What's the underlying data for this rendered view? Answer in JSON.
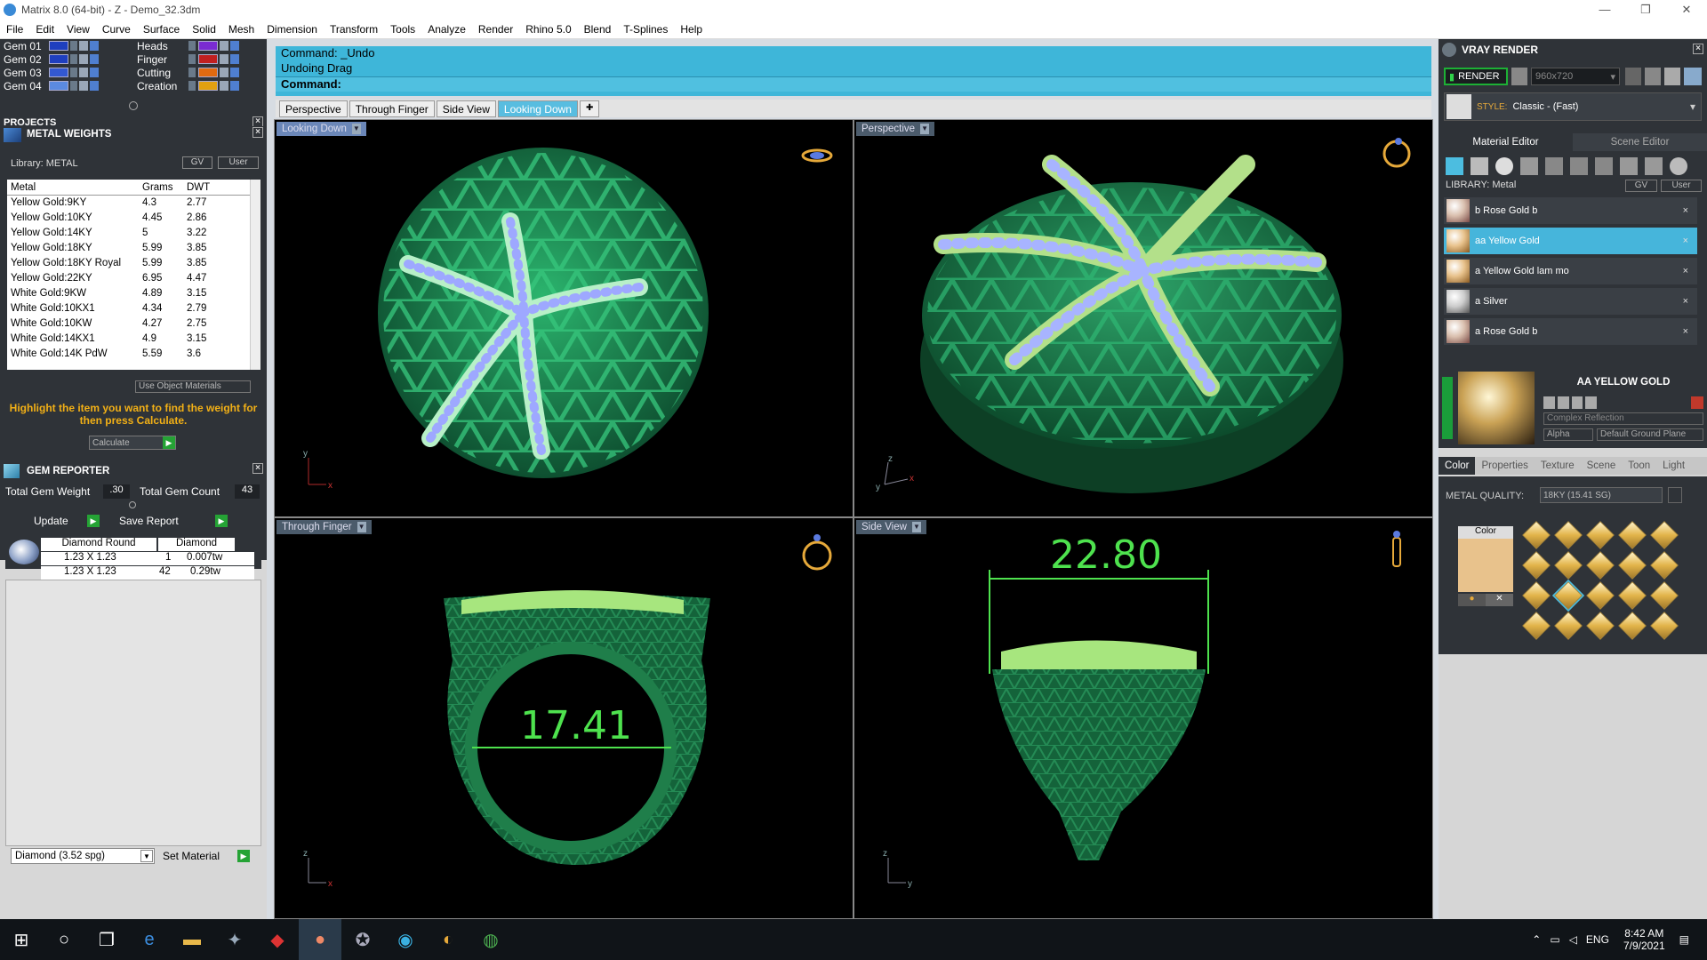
{
  "window": {
    "title": "Matrix 8.0 (64-bit) - Z - Demo_32.3dm",
    "controls": [
      "—",
      "❐",
      "✕"
    ]
  },
  "menu": [
    "File",
    "Edit",
    "View",
    "Curve",
    "Surface",
    "Solid",
    "Mesh",
    "Dimension",
    "Transform",
    "Tools",
    "Analyze",
    "Render",
    "Rhino 5.0",
    "Blend",
    "T-Splines",
    "Help"
  ],
  "layers": {
    "left": [
      "Gem 01",
      "Gem 02",
      "Gem 03",
      "Gem 04"
    ],
    "right": [
      "Heads",
      "Finger",
      "Cutting",
      "Creation"
    ],
    "left_colors": [
      "#1f3fbf",
      "#1f3fbf",
      "#3358d0",
      "#5b8ae0"
    ],
    "right_colors": [
      "#7a2bd1",
      "#c02020",
      "#e06a10",
      "#e2a010"
    ]
  },
  "projects": {
    "title": "PROJECTS"
  },
  "metal_weights": {
    "title": "METAL WEIGHTS",
    "library_label": "Library: METAL",
    "gv_label": "GV",
    "user_label": "User",
    "columns": [
      "Metal",
      "Grams",
      "DWT"
    ],
    "rows": [
      [
        "Yellow Gold:9KY",
        "4.3",
        "2.77"
      ],
      [
        "Yellow Gold:10KY",
        "4.45",
        "2.86"
      ],
      [
        "Yellow Gold:14KY",
        "5",
        "3.22"
      ],
      [
        "Yellow Gold:18KY",
        "5.99",
        "3.85"
      ],
      [
        "Yellow Gold:18KY Royal",
        "5.99",
        "3.85"
      ],
      [
        "Yellow Gold:22KY",
        "6.95",
        "4.47"
      ],
      [
        "White Gold:9KW",
        "4.89",
        "3.15"
      ],
      [
        "White Gold:10KX1",
        "4.34",
        "2.79"
      ],
      [
        "White Gold:10KW",
        "4.27",
        "2.75"
      ],
      [
        "White Gold:14KX1",
        "4.9",
        "3.15"
      ],
      [
        "White Gold:14K PdW",
        "5.59",
        "3.6"
      ]
    ],
    "use_object_materials": "Use Object Materials",
    "hint": "Highlight the item you want to find the weight for then press Calculate.",
    "calculate": "Calculate"
  },
  "gem_reporter": {
    "title": "GEM REPORTER",
    "total_weight_label": "Total Gem Weight",
    "total_weight": ".30",
    "total_count_label": "Total Gem Count",
    "total_count": "43",
    "update": "Update",
    "save_report": "Save Report",
    "columns": [
      "Diamond Round",
      "Diamond"
    ],
    "rows": [
      [
        "1.23 X 1.23",
        "1",
        "0.007tw"
      ],
      [
        "1.23 X 1.23",
        "42",
        "0.29tw"
      ]
    ],
    "material_select": "Diamond     (3.52 spg)",
    "set_material": "Set Material"
  },
  "command": {
    "line1": "Command: _Undo",
    "line2": "Undoing Drag",
    "prompt": "Command:"
  },
  "viewport_tabs": [
    "Perspective",
    "Through Finger",
    "Side View",
    "Looking Down"
  ],
  "active_tab": "Looking Down",
  "add_tab_symbol": "✚",
  "viewports": {
    "top_left": "Looking Down",
    "top_right": "Perspective",
    "bottom_left": "Through Finger",
    "bottom_right": "Side View"
  },
  "axis_labels": {
    "tl": [
      "y",
      "x"
    ],
    "tr": [
      "z",
      "y",
      "x"
    ],
    "bl": [
      "z",
      "x"
    ],
    "br": [
      "z",
      "y"
    ]
  },
  "dimensions": {
    "width": "22.80",
    "finger": "17.41"
  },
  "vray": {
    "title": "VRAY RENDER",
    "render_btn": "RENDER",
    "resolution": "960x720",
    "style_label": "STYLE:",
    "style_value": "Classic - (Fast)",
    "tabs": [
      "Material Editor",
      "Scene Editor"
    ],
    "library_label": "LIBRARY: Metal",
    "gv": "GV",
    "user": "User",
    "materials": [
      "b Rose Gold b",
      "aa Yellow Gold",
      "a Yellow Gold lam mo",
      "a Silver",
      "a Rose Gold b"
    ],
    "selected_material": "AA YELLOW GOLD",
    "reflection": "Complex Reflection",
    "alpha": "Alpha",
    "ground": "Default Ground Plane",
    "subtabs": [
      "Color",
      "Properties",
      "Texture",
      "Scene",
      "Toon",
      "Light"
    ],
    "metal_quality_label": "METAL QUALITY:",
    "metal_quality_value": "18KY        (15.41 SG)",
    "color_label": "Color",
    "swatch_color": "#e8c28c"
  },
  "taskbar": {
    "lang": "ENG",
    "time": "8:42 AM",
    "date": "7/9/2021"
  }
}
